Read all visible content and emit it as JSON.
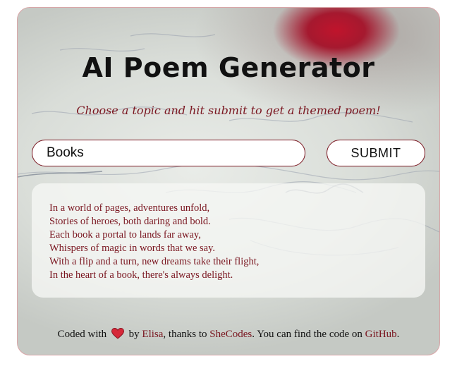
{
  "app": {
    "title": "AI Poem Generator",
    "subtitle": "Choose a topic and hit submit to get a themed poem!"
  },
  "form": {
    "topic_value": "Books",
    "submit_label": "SUBMIT"
  },
  "poem": {
    "lines": [
      "In a world of pages, adventures unfold,",
      "Stories of heroes, both daring and bold.",
      "Each book a portal to lands far away,",
      "Whispers of magic in words that we say.",
      "With a flip and a turn, new dreams take their flight,",
      "In the heart of a book, there's always delight."
    ]
  },
  "footer": {
    "coded_with": "Coded with",
    "heart_icon": "heart-icon",
    "by": "by",
    "author_link": "Elisa",
    "thanks_to": ", thanks to",
    "shecodes_link": "SheCodes",
    "find_code": ". You can find the code on",
    "github_link": "GitHub",
    "end": "."
  },
  "colors": {
    "accent": "#7a1620",
    "heart": "#d62839",
    "text": "#111111"
  }
}
